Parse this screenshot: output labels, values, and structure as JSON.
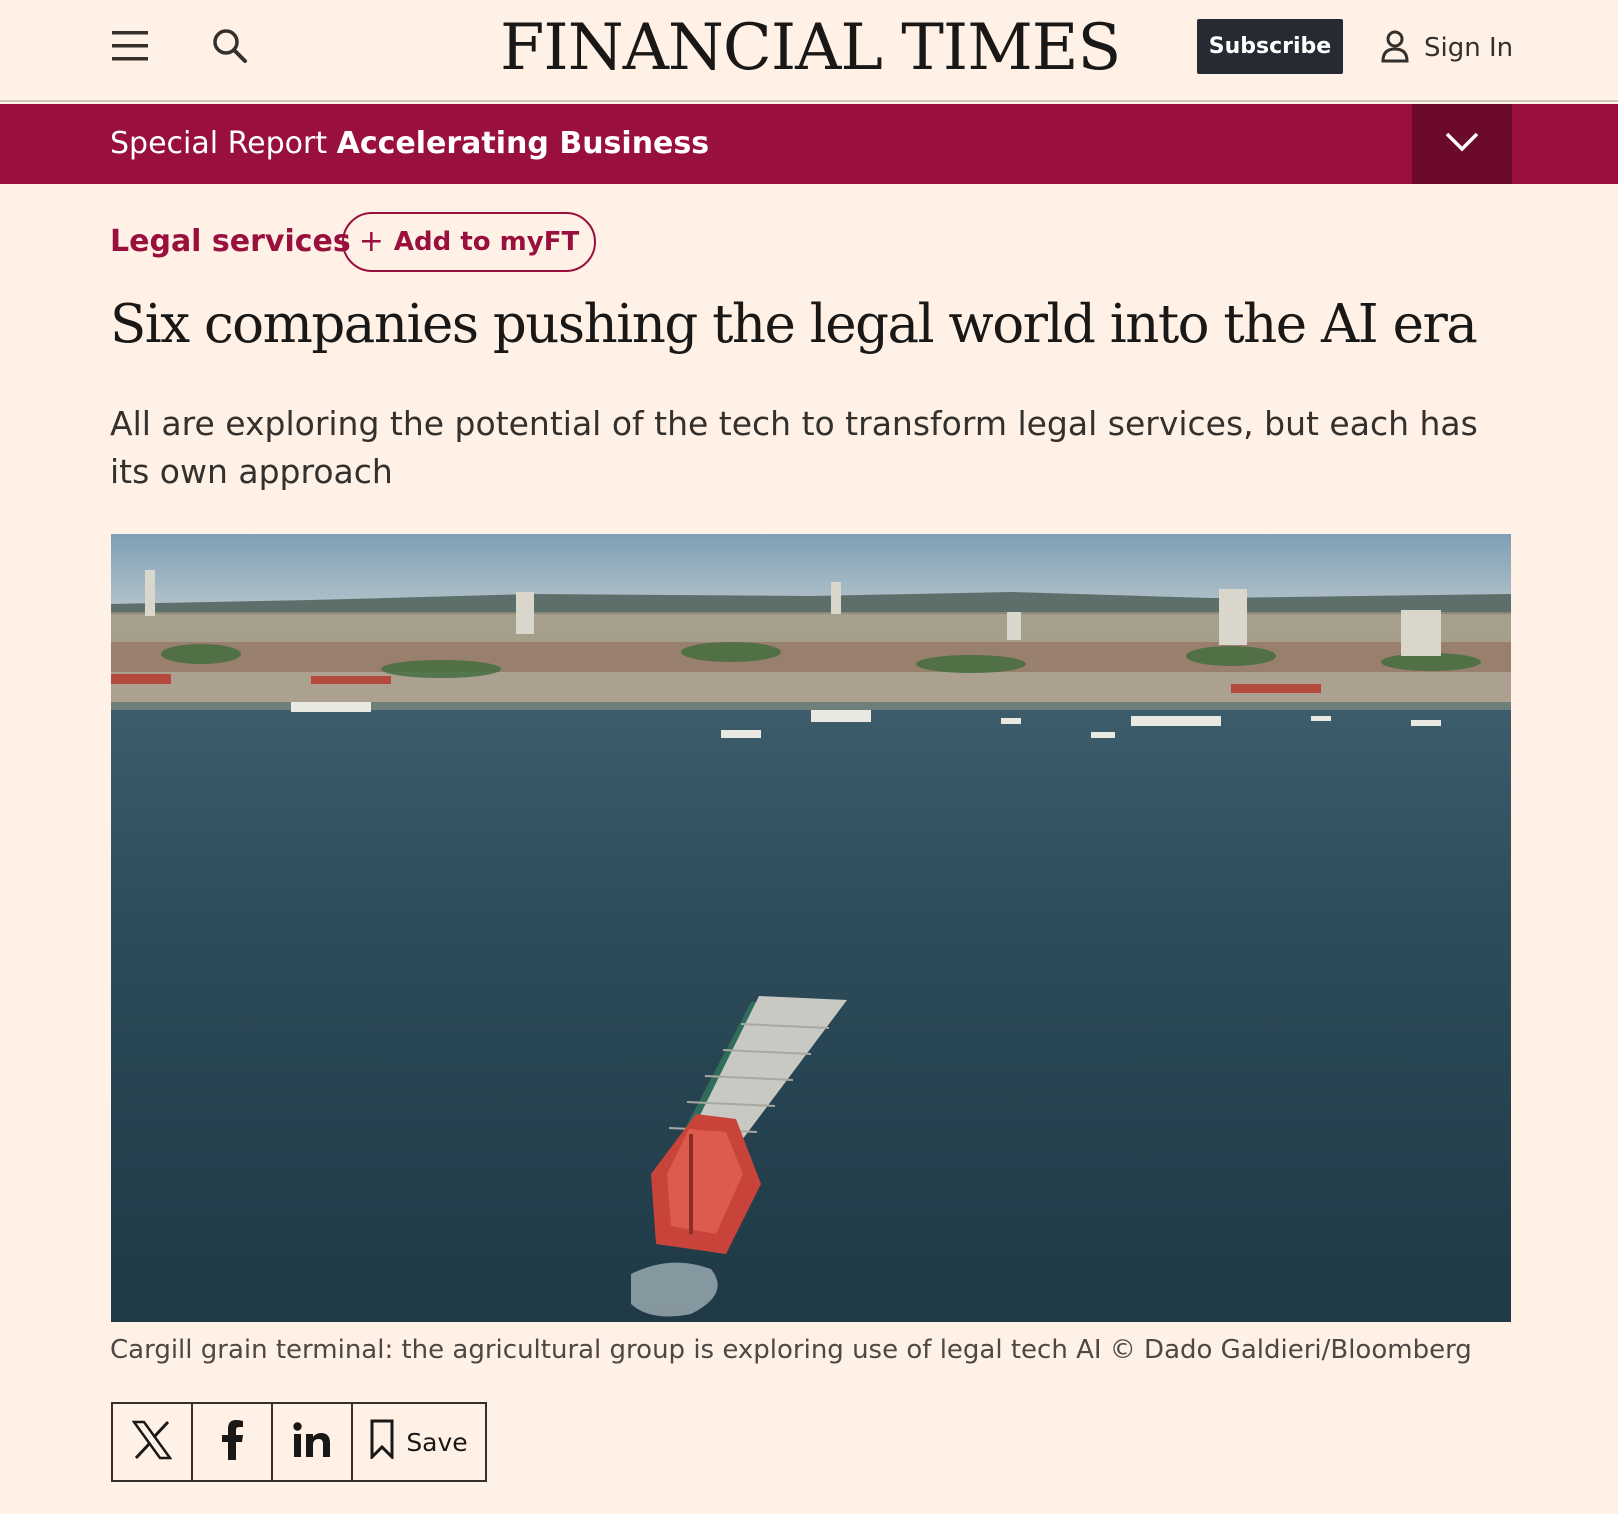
{
  "header": {
    "masthead": "FINANCIAL TIMES",
    "subscribe_label": "Subscribe",
    "signin_label": "Sign In",
    "icons": [
      "menu-icon",
      "search-icon",
      "user-icon"
    ]
  },
  "special_report": {
    "prefix": "Special Report",
    "name": "Accelerating Business",
    "toggle_icon": "chevron-down-icon"
  },
  "article": {
    "topic": "Legal services",
    "add_to_myft_label": "Add to myFT",
    "headline": "Six companies pushing the legal world into the AI era",
    "standfirst": "All are exploring the potential of the tech to transform legal services, but each has its own approach",
    "caption": "Cargill grain terminal: the agricultural group is exploring use of legal tech AI © Dado Galdieri/Bloomberg"
  },
  "share": {
    "icons": [
      "x-icon",
      "facebook-icon",
      "linkedin-icon",
      "bookmark-icon"
    ],
    "save_label": "Save"
  },
  "colors": {
    "background": "#fff1e5",
    "claret": "#990f3d",
    "claret_dark": "#6b0a2a",
    "subscribe_bg": "#262a33",
    "text": "#33302e"
  }
}
